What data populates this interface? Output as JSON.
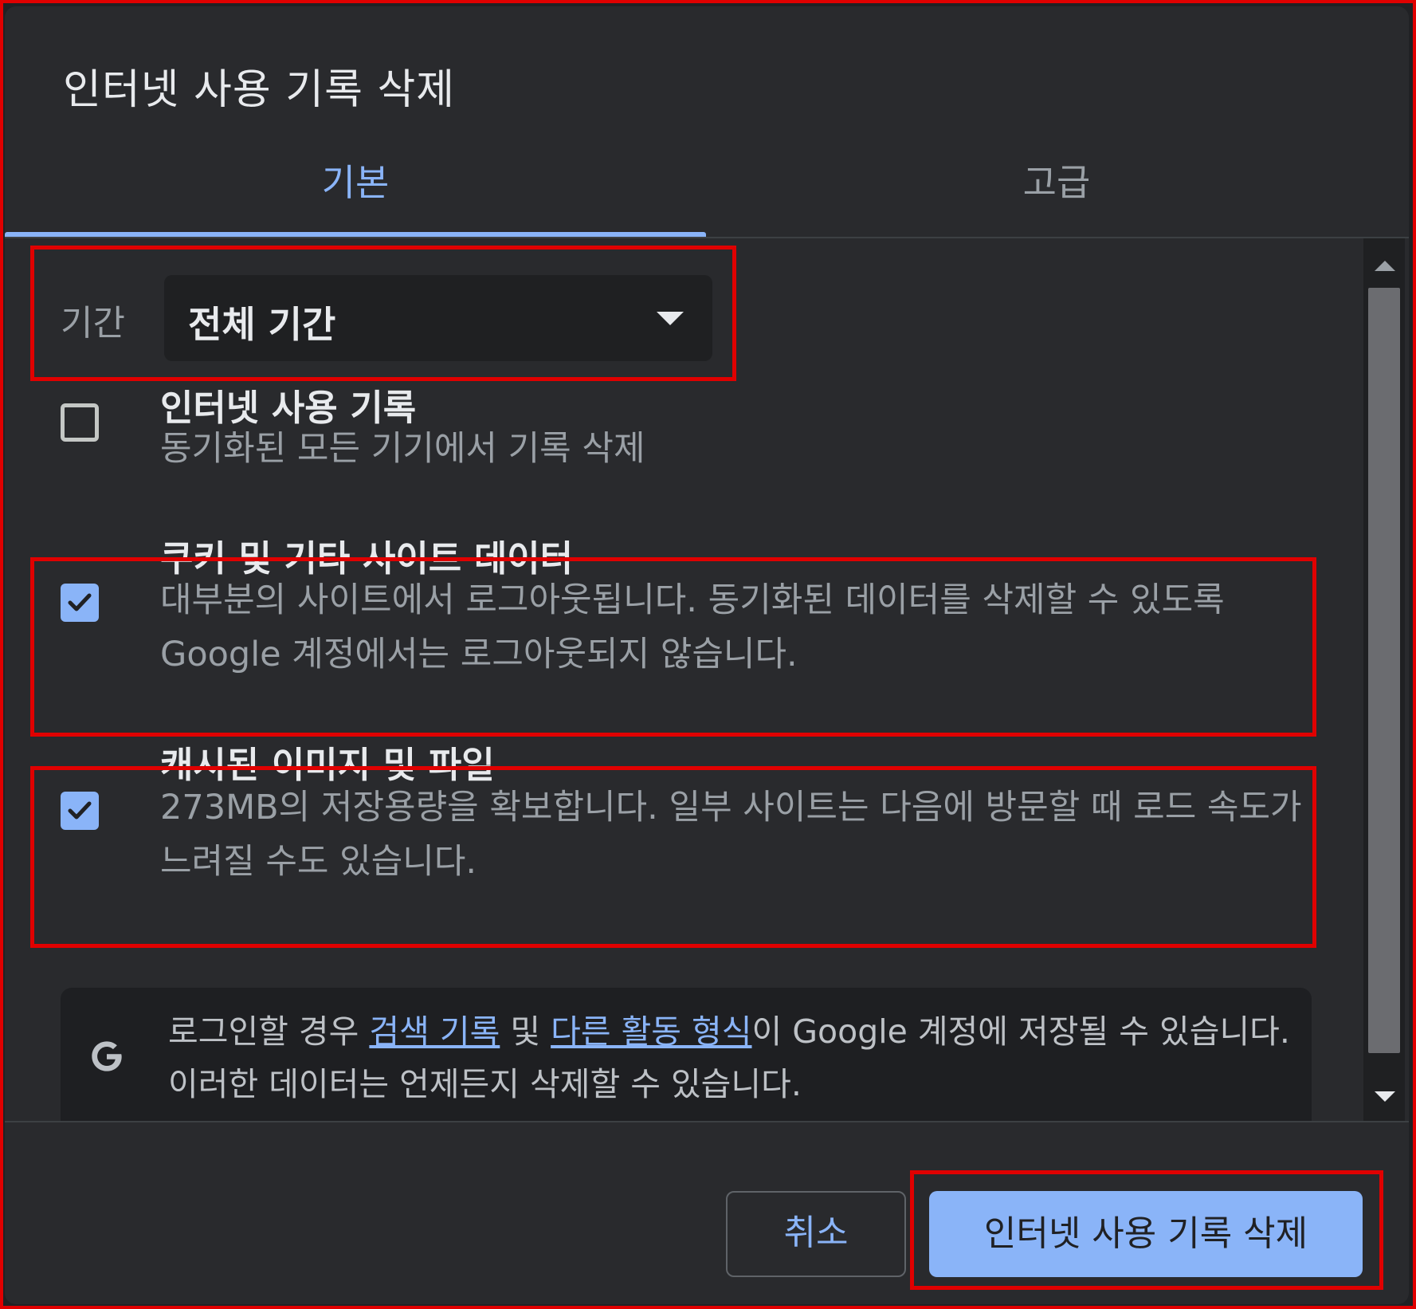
{
  "dialog": {
    "title": "인터넷 사용 기록 삭제",
    "tabs": [
      {
        "label": "기본",
        "active": true
      },
      {
        "label": "고급",
        "active": false
      }
    ],
    "time_range": {
      "label": "기간",
      "selected": "전체 기간"
    },
    "options": [
      {
        "title": "인터넷 사용 기록",
        "description": "동기화된 모든 기기에서 기록 삭제",
        "checked": false
      },
      {
        "title": "쿠키 및 기타 사이트 데이터",
        "description": "대부분의 사이트에서 로그아웃됩니다. 동기화된 데이터를 삭제할 수 있도록 Google 계정에서는 로그아웃되지 않습니다.",
        "checked": true
      },
      {
        "title": "캐시된 이미지 및 파일",
        "description": "273MB의 저장용량을 확보합니다. 일부 사이트는 다음에 방문할 때 로드 속도가 느려질 수도 있습니다.",
        "checked": true
      }
    ],
    "google_notice": {
      "text_before": "로그인할 경우 ",
      "link_search_history": "검색 기록",
      "text_and": " 및 ",
      "link_other_activity": "다른 활동 형식",
      "text_after": "이 Google 계정에 저장될 수 있습니다. 이러한 데이터는 언제든지 삭제할 수 있습니다.",
      "icon": "google-g-icon"
    },
    "buttons": {
      "cancel": "취소",
      "confirm": "인터넷 사용 기록 삭제"
    }
  },
  "colors": {
    "background": "#292a2d",
    "accent": "#8ab4f8",
    "highlight": "#e00000"
  }
}
